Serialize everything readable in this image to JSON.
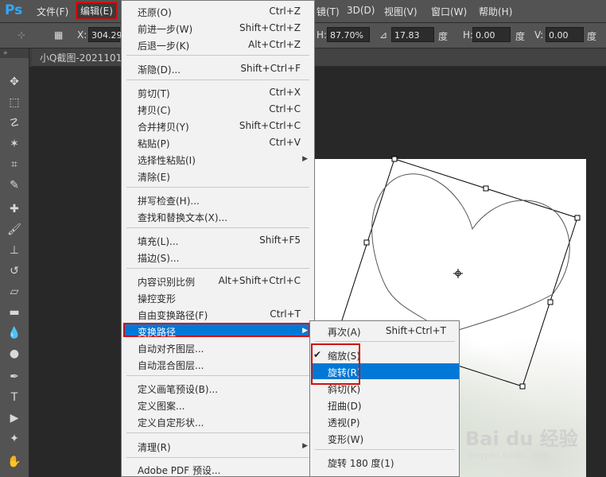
{
  "app": {
    "logo": "Ps"
  },
  "menubar": {
    "items": [
      "文件(F)",
      "编辑(E)",
      "镜(T)",
      "3D(D)",
      "视图(V)",
      "窗口(W)",
      "帮助(H)"
    ]
  },
  "options": {
    "x_label": "X:",
    "x_value": "304.29",
    "h_label": "H:",
    "h_value": "87.70%",
    "angle_value": "17.83",
    "angle_unit": "度",
    "h2_label": "H:",
    "h2_value": "0.00",
    "h2_unit": "度",
    "v_label": "V:",
    "v_value": "0.00",
    "v_unit": "度"
  },
  "document": {
    "tab_title": "小Q截图-2021101"
  },
  "edit_menu": {
    "items": [
      {
        "label": "还原(O)",
        "shortcut": "Ctrl+Z"
      },
      {
        "label": "前进一步(W)",
        "shortcut": "Shift+Ctrl+Z"
      },
      {
        "label": "后退一步(K)",
        "shortcut": "Alt+Ctrl+Z"
      },
      {
        "label": "渐隐(D)...",
        "shortcut": "Shift+Ctrl+F"
      },
      {
        "label": "剪切(T)",
        "shortcut": "Ctrl+X"
      },
      {
        "label": "拷贝(C)",
        "shortcut": "Ctrl+C"
      },
      {
        "label": "合并拷贝(Y)",
        "shortcut": "Shift+Ctrl+C"
      },
      {
        "label": "粘贴(P)",
        "shortcut": "Ctrl+V"
      },
      {
        "label": "选择性粘贴(I)",
        "shortcut": ""
      },
      {
        "label": "清除(E)",
        "shortcut": ""
      },
      {
        "label": "拼写检查(H)...",
        "shortcut": ""
      },
      {
        "label": "查找和替换文本(X)...",
        "shortcut": ""
      },
      {
        "label": "填充(L)...",
        "shortcut": "Shift+F5"
      },
      {
        "label": "描边(S)...",
        "shortcut": ""
      },
      {
        "label": "内容识别比例",
        "shortcut": "Alt+Shift+Ctrl+C"
      },
      {
        "label": "操控变形",
        "shortcut": ""
      },
      {
        "label": "自由变换路径(F)",
        "shortcut": "Ctrl+T"
      },
      {
        "label": "变换路径",
        "shortcut": ""
      },
      {
        "label": "自动对齐图层...",
        "shortcut": ""
      },
      {
        "label": "自动混合图层...",
        "shortcut": ""
      },
      {
        "label": "定义画笔预设(B)...",
        "shortcut": ""
      },
      {
        "label": "定义图案...",
        "shortcut": ""
      },
      {
        "label": "定义自定形状...",
        "shortcut": ""
      },
      {
        "label": "清理(R)",
        "shortcut": ""
      },
      {
        "label": "Adobe PDF 预设...",
        "shortcut": ""
      }
    ]
  },
  "transform_submenu": {
    "items": [
      {
        "label": "再次(A)",
        "shortcut": "Shift+Ctrl+T"
      },
      {
        "label": "缩放(S)",
        "shortcut": ""
      },
      {
        "label": "旋转(R)",
        "shortcut": ""
      },
      {
        "label": "斜切(K)",
        "shortcut": ""
      },
      {
        "label": "扭曲(D)",
        "shortcut": ""
      },
      {
        "label": "透视(P)",
        "shortcut": ""
      },
      {
        "label": "变形(W)",
        "shortcut": ""
      },
      {
        "label": "旋转 180 度(1)",
        "shortcut": ""
      }
    ]
  },
  "watermark": {
    "brand": "Bai du 经验",
    "url": "jingyan.baidu.com"
  },
  "colors": {
    "highlight": "#0078d7",
    "annotation_red": "#d01010",
    "ps_blue": "#31a8ff"
  }
}
